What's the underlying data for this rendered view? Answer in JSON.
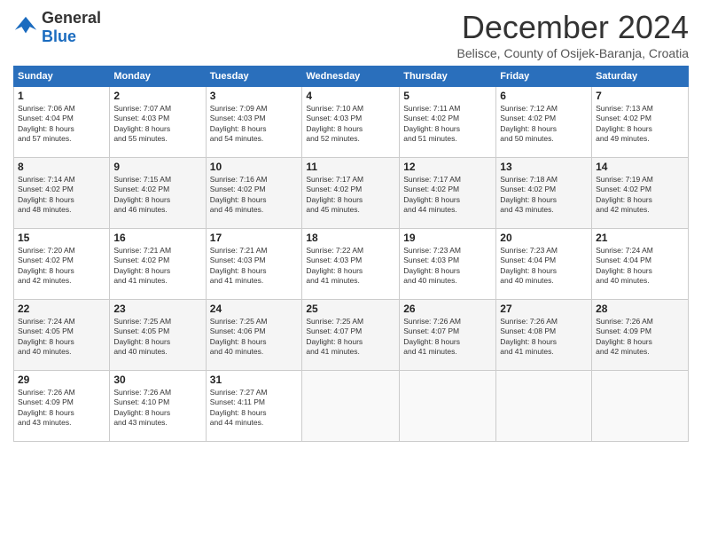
{
  "header": {
    "logo_general": "General",
    "logo_blue": "Blue",
    "month": "December 2024",
    "location": "Belisce, County of Osijek-Baranja, Croatia"
  },
  "weekdays": [
    "Sunday",
    "Monday",
    "Tuesday",
    "Wednesday",
    "Thursday",
    "Friday",
    "Saturday"
  ],
  "weeks": [
    [
      {
        "day": 1,
        "info": "Sunrise: 7:06 AM\nSunset: 4:04 PM\nDaylight: 8 hours\nand 57 minutes."
      },
      {
        "day": 2,
        "info": "Sunrise: 7:07 AM\nSunset: 4:03 PM\nDaylight: 8 hours\nand 55 minutes."
      },
      {
        "day": 3,
        "info": "Sunrise: 7:09 AM\nSunset: 4:03 PM\nDaylight: 8 hours\nand 54 minutes."
      },
      {
        "day": 4,
        "info": "Sunrise: 7:10 AM\nSunset: 4:03 PM\nDaylight: 8 hours\nand 52 minutes."
      },
      {
        "day": 5,
        "info": "Sunrise: 7:11 AM\nSunset: 4:02 PM\nDaylight: 8 hours\nand 51 minutes."
      },
      {
        "day": 6,
        "info": "Sunrise: 7:12 AM\nSunset: 4:02 PM\nDaylight: 8 hours\nand 50 minutes."
      },
      {
        "day": 7,
        "info": "Sunrise: 7:13 AM\nSunset: 4:02 PM\nDaylight: 8 hours\nand 49 minutes."
      }
    ],
    [
      {
        "day": 8,
        "info": "Sunrise: 7:14 AM\nSunset: 4:02 PM\nDaylight: 8 hours\nand 48 minutes."
      },
      {
        "day": 9,
        "info": "Sunrise: 7:15 AM\nSunset: 4:02 PM\nDaylight: 8 hours\nand 46 minutes."
      },
      {
        "day": 10,
        "info": "Sunrise: 7:16 AM\nSunset: 4:02 PM\nDaylight: 8 hours\nand 46 minutes."
      },
      {
        "day": 11,
        "info": "Sunrise: 7:17 AM\nSunset: 4:02 PM\nDaylight: 8 hours\nand 45 minutes."
      },
      {
        "day": 12,
        "info": "Sunrise: 7:17 AM\nSunset: 4:02 PM\nDaylight: 8 hours\nand 44 minutes."
      },
      {
        "day": 13,
        "info": "Sunrise: 7:18 AM\nSunset: 4:02 PM\nDaylight: 8 hours\nand 43 minutes."
      },
      {
        "day": 14,
        "info": "Sunrise: 7:19 AM\nSunset: 4:02 PM\nDaylight: 8 hours\nand 42 minutes."
      }
    ],
    [
      {
        "day": 15,
        "info": "Sunrise: 7:20 AM\nSunset: 4:02 PM\nDaylight: 8 hours\nand 42 minutes."
      },
      {
        "day": 16,
        "info": "Sunrise: 7:21 AM\nSunset: 4:02 PM\nDaylight: 8 hours\nand 41 minutes."
      },
      {
        "day": 17,
        "info": "Sunrise: 7:21 AM\nSunset: 4:03 PM\nDaylight: 8 hours\nand 41 minutes."
      },
      {
        "day": 18,
        "info": "Sunrise: 7:22 AM\nSunset: 4:03 PM\nDaylight: 8 hours\nand 41 minutes."
      },
      {
        "day": 19,
        "info": "Sunrise: 7:23 AM\nSunset: 4:03 PM\nDaylight: 8 hours\nand 40 minutes."
      },
      {
        "day": 20,
        "info": "Sunrise: 7:23 AM\nSunset: 4:04 PM\nDaylight: 8 hours\nand 40 minutes."
      },
      {
        "day": 21,
        "info": "Sunrise: 7:24 AM\nSunset: 4:04 PM\nDaylight: 8 hours\nand 40 minutes."
      }
    ],
    [
      {
        "day": 22,
        "info": "Sunrise: 7:24 AM\nSunset: 4:05 PM\nDaylight: 8 hours\nand 40 minutes."
      },
      {
        "day": 23,
        "info": "Sunrise: 7:25 AM\nSunset: 4:05 PM\nDaylight: 8 hours\nand 40 minutes."
      },
      {
        "day": 24,
        "info": "Sunrise: 7:25 AM\nSunset: 4:06 PM\nDaylight: 8 hours\nand 40 minutes."
      },
      {
        "day": 25,
        "info": "Sunrise: 7:25 AM\nSunset: 4:07 PM\nDaylight: 8 hours\nand 41 minutes."
      },
      {
        "day": 26,
        "info": "Sunrise: 7:26 AM\nSunset: 4:07 PM\nDaylight: 8 hours\nand 41 minutes."
      },
      {
        "day": 27,
        "info": "Sunrise: 7:26 AM\nSunset: 4:08 PM\nDaylight: 8 hours\nand 41 minutes."
      },
      {
        "day": 28,
        "info": "Sunrise: 7:26 AM\nSunset: 4:09 PM\nDaylight: 8 hours\nand 42 minutes."
      }
    ],
    [
      {
        "day": 29,
        "info": "Sunrise: 7:26 AM\nSunset: 4:09 PM\nDaylight: 8 hours\nand 43 minutes."
      },
      {
        "day": 30,
        "info": "Sunrise: 7:26 AM\nSunset: 4:10 PM\nDaylight: 8 hours\nand 43 minutes."
      },
      {
        "day": 31,
        "info": "Sunrise: 7:27 AM\nSunset: 4:11 PM\nDaylight: 8 hours\nand 44 minutes."
      },
      null,
      null,
      null,
      null
    ]
  ]
}
